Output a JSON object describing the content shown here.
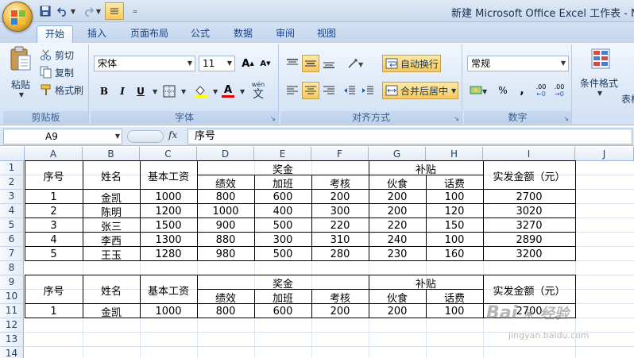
{
  "app": {
    "window_title": "新建 Microsoft Office Excel 工作表 - Mic"
  },
  "ribbon": {
    "tabs": [
      "开始",
      "插入",
      "页面布局",
      "公式",
      "数据",
      "审阅",
      "视图"
    ],
    "clipboard": {
      "paste_label": "粘贴",
      "cut_label": "剪切",
      "copy_label": "复制",
      "format_painter_label": "格式刷",
      "group_label": "剪贴板"
    },
    "font": {
      "font_name": "宋体",
      "font_size": "11",
      "group_label": "字体",
      "bold": "B",
      "italic": "I",
      "underline": "U",
      "font_color_glyph": "A",
      "phonetic_label": "wén",
      "phonetic_glyph": "文",
      "grow_glyph": "A",
      "shrink_glyph": "A"
    },
    "alignment": {
      "wrap_text_label": "自动换行",
      "merge_center_label": "合并后居中",
      "group_label": "对齐方式"
    },
    "number": {
      "format_value": "常规",
      "percent_glyph": "%",
      "comma_glyph": ",",
      "inc_decimal": ".00",
      "dec_decimal": ".00",
      "group_label": "数字"
    },
    "styles": {
      "conditional_format_label": "条件格式",
      "table_label_partial": "表格"
    }
  },
  "formula_bar": {
    "name_box": "A9",
    "fx": "fx",
    "formula": "序号"
  },
  "grid": {
    "columns": [
      "A",
      "B",
      "C",
      "D",
      "E",
      "F",
      "G",
      "H",
      "I",
      "J"
    ],
    "rows": [
      "1",
      "2",
      "3",
      "4",
      "5",
      "6",
      "7",
      "8",
      "9",
      "10",
      "11",
      "12",
      "13",
      "14"
    ],
    "headers": {
      "seq": "序号",
      "name": "姓名",
      "base_salary": "基本工资",
      "bonus": "奖金",
      "performance": "绩效",
      "overtime": "加班",
      "assessment": "考核",
      "allowance": "补贴",
      "meals": "伙食",
      "phone": "话费",
      "actual_pay": "实发金额（元）"
    },
    "table1_rows": [
      [
        "1",
        "金凯",
        "1000",
        "800",
        "600",
        "200",
        "200",
        "100",
        "2700"
      ],
      [
        "2",
        "陈明",
        "1200",
        "1000",
        "400",
        "300",
        "200",
        "120",
        "3020"
      ],
      [
        "3",
        "张三",
        "1500",
        "900",
        "500",
        "220",
        "220",
        "150",
        "3270"
      ],
      [
        "4",
        "李西",
        "1300",
        "880",
        "300",
        "310",
        "240",
        "100",
        "2890"
      ],
      [
        "5",
        "王玉",
        "1280",
        "980",
        "500",
        "280",
        "230",
        "160",
        "3200"
      ]
    ],
    "table2_rows": [
      [
        "1",
        "金凯",
        "1000",
        "800",
        "600",
        "200",
        "200",
        "100",
        "2700"
      ]
    ]
  },
  "watermark": {
    "brand": "Bai",
    "brand_rest": "经验",
    "url": "jingyan.baidu.com"
  }
}
